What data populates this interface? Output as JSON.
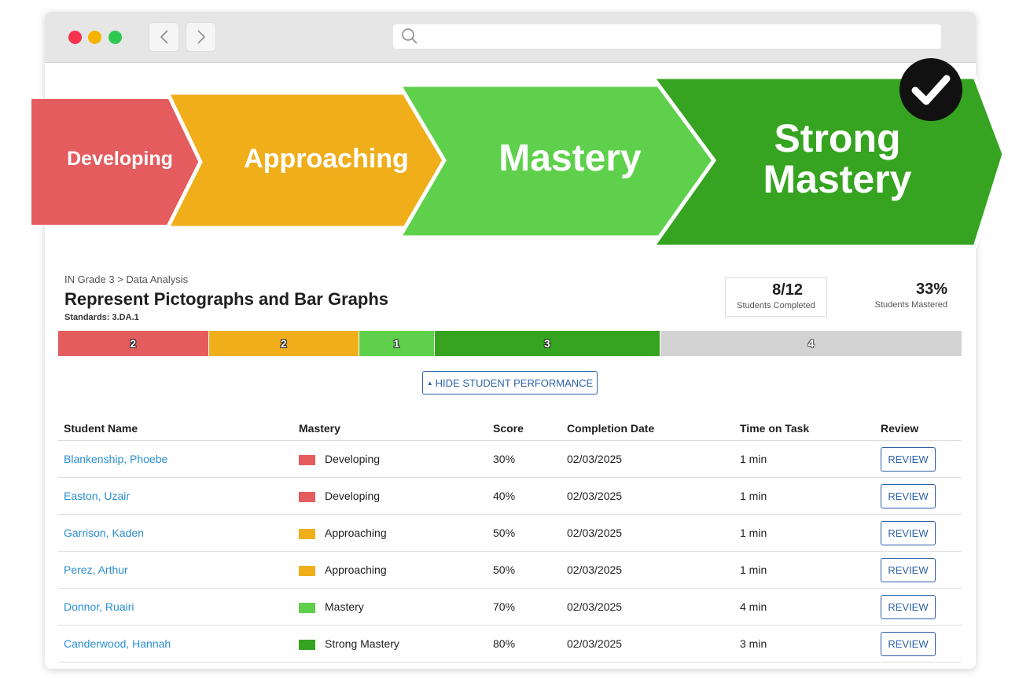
{
  "banner": {
    "levels": [
      {
        "label": "Developing",
        "color": "#e45c5e"
      },
      {
        "label": "Approaching",
        "color": "#f0ae1b"
      },
      {
        "label": "Mastery",
        "color": "#5fd04b"
      },
      {
        "label_line1": "Strong",
        "label_line2": "Mastery",
        "color": "#36a321"
      }
    ],
    "check_icon": "checkmark-icon"
  },
  "page": {
    "breadcrumb": "IN Grade 3 > Data Analysis",
    "title": "Represent Pictographs and Bar Graphs",
    "standards": "Standards: 3.DA.1",
    "stats": {
      "completed_value": "8/12",
      "completed_label": "Students Completed",
      "mastered_value": "33%",
      "mastered_label": "Students Mastered"
    },
    "distribution": [
      {
        "count": "2",
        "color": "#e45c5e"
      },
      {
        "count": "2",
        "color": "#f0ae1b"
      },
      {
        "count": "1",
        "color": "#5fd04b"
      },
      {
        "count": "3",
        "color": "#36a321"
      },
      {
        "count": "4",
        "color": "#d3d3d3"
      }
    ],
    "toggle_label": "HIDE STUDENT PERFORMANCE"
  },
  "table": {
    "headers": [
      "Student Name",
      "Mastery",
      "Score",
      "Completion Date",
      "Time on Task",
      "Review"
    ],
    "review_label": "REVIEW",
    "rows": [
      {
        "name": "Blankenship, Phoebe",
        "mastery": "Developing",
        "color": "#e45c5e",
        "score": "30%",
        "date": "02/03/2025",
        "time": "1 min"
      },
      {
        "name": "Easton, Uzair",
        "mastery": "Developing",
        "color": "#e45c5e",
        "score": "40%",
        "date": "02/03/2025",
        "time": "1 min"
      },
      {
        "name": "Garrison, Kaden",
        "mastery": "Approaching",
        "color": "#f0ae1b",
        "score": "50%",
        "date": "02/03/2025",
        "time": "1 min"
      },
      {
        "name": "Perez, Arthur",
        "mastery": "Approaching",
        "color": "#f0ae1b",
        "score": "50%",
        "date": "02/03/2025",
        "time": "1 min"
      },
      {
        "name": "Donnor, Ruairi",
        "mastery": "Mastery",
        "color": "#5fd04b",
        "score": "70%",
        "date": "02/03/2025",
        "time": "4 min"
      },
      {
        "name": "Canderwood, Hannah",
        "mastery": "Strong Mastery",
        "color": "#36a321",
        "score": "80%",
        "date": "02/03/2025",
        "time": "3 min"
      }
    ]
  }
}
